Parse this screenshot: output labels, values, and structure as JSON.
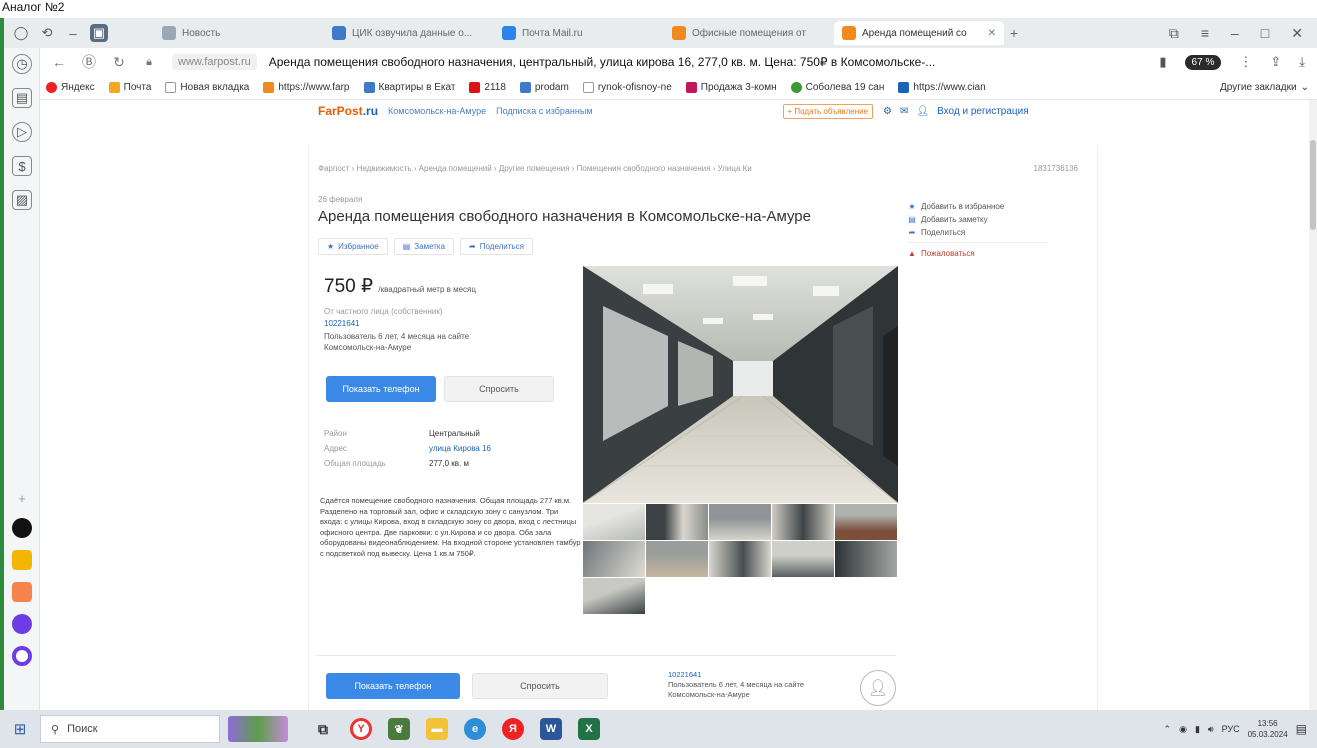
{
  "caption": "Аналог №2",
  "tabs": [
    {
      "label": "Новость",
      "color": "#9aa7b5"
    },
    {
      "label": "ЦИК озвучила данные о...",
      "color": "#3f7ac9"
    },
    {
      "label": "Почта Mail.ru",
      "color": "#2b84e8"
    },
    {
      "label": "Офисные помещения от",
      "color": "#f08a1c"
    },
    {
      "label": "Аренда помещений со",
      "color": "#f08a1c",
      "active": true
    }
  ],
  "address": {
    "domain": "www.farpost.ru",
    "title": "Аренда помещения свободного назначения, центральный, улица кирова 16, 277,0 кв. м. Цена: 750₽ в Комсомольске-...",
    "zoom": "67 %"
  },
  "bookmarks": [
    {
      "label": "Яндекс",
      "color": "#e22"
    },
    {
      "label": "Почта",
      "color": "#f5a623"
    },
    {
      "label": "Новая вкладка",
      "color": "#999"
    },
    {
      "label": "https://www.farp",
      "color": "#f08a1c"
    },
    {
      "label": "Квартиры в Екат",
      "color": "#3f7ac9"
    },
    {
      "label": "2118",
      "color": "#d11"
    },
    {
      "label": "prodam",
      "color": "#3f7ac9"
    },
    {
      "label": "rynok-ofisnoy-ne",
      "color": "#999"
    },
    {
      "label": "Продажа 3-комн",
      "color": "#c2185b"
    },
    {
      "label": "Соболева 19 сан",
      "color": "#3a9a3a"
    },
    {
      "label": "https://www.cian",
      "color": "#1a62b8"
    }
  ],
  "bookmarks_more": "Другие закладки",
  "site": {
    "logo_main": "FarPost",
    "logo_tld": ".ru",
    "city": "Комсомольск-на-Амуре",
    "subscribe": "Подписка с избранным",
    "post_ad": "+ Подать объявление",
    "login": "Вход и регистрация"
  },
  "breadcrumbs": "Фарпост › Недвижимость › Аренда помещений › Другие помещения › Помещения свободного назначения › Улица Ки",
  "ad_number": "1831736136",
  "listing": {
    "date": "26 февраля",
    "title": "Аренда помещения свободного назначения в Комсомольске-на-Амуре",
    "actions": [
      {
        "icon": "★",
        "label": "Избранное"
      },
      {
        "icon": "▤",
        "label": "Заметка"
      },
      {
        "icon": "➦",
        "label": "Поделиться"
      }
    ],
    "price": "750 ₽",
    "price_unit": "/квадратный метр в месяц",
    "seller_label": "От частного лица (собственник)",
    "seller_id": "10221641",
    "seller_info": "Пользователь 6 лет, 4 месяца на сайте\nКомсомольск-на-Амуре",
    "phone_button": "Показать телефон",
    "ask_button": "Спросить",
    "props": [
      {
        "key": "Район",
        "value": "Центральный",
        "link": false
      },
      {
        "key": "Адрес",
        "value": "улица Кирова 16",
        "link": true
      },
      {
        "key": "Общая площадь",
        "value": "277,0 кв. м",
        "link": false
      }
    ],
    "description": "Сдаётся помещение свободного назначения. Общая площадь 277 кв.м. Разделено на торговый зал, офис и складскую зону с санузлом. Три входа: с улицы Кирова, вход в складскую зону со двора, вход с лестницы офисного центра. Две парковки: с ул.Кирова и со двора. Оба зала оборудованы видеонаблюдением. На входной стороне установлен тамбур с подсветкой под вывеску. Цена 1 кв.м 750₽."
  },
  "side_menu": [
    {
      "icon": "★",
      "label": "Добавить в избранное"
    },
    {
      "icon": "▤",
      "label": "Добавить заметку"
    },
    {
      "icon": "➦",
      "label": "Поделиться"
    },
    {
      "icon": "▲",
      "label": "Пожаловаться",
      "warn": true
    }
  ],
  "bottom": {
    "phone_button": "Показать телефон",
    "ask_button": "Спросить",
    "seller_id": "10221641",
    "seller_info": "Пользователь 6 лет, 4 месяца на сайте\nКомсомольск-на-Амуре"
  },
  "taskbar": {
    "search_placeholder": "Поиск",
    "lang": "РУС",
    "time": "13:56",
    "date": "05.03.2024"
  }
}
